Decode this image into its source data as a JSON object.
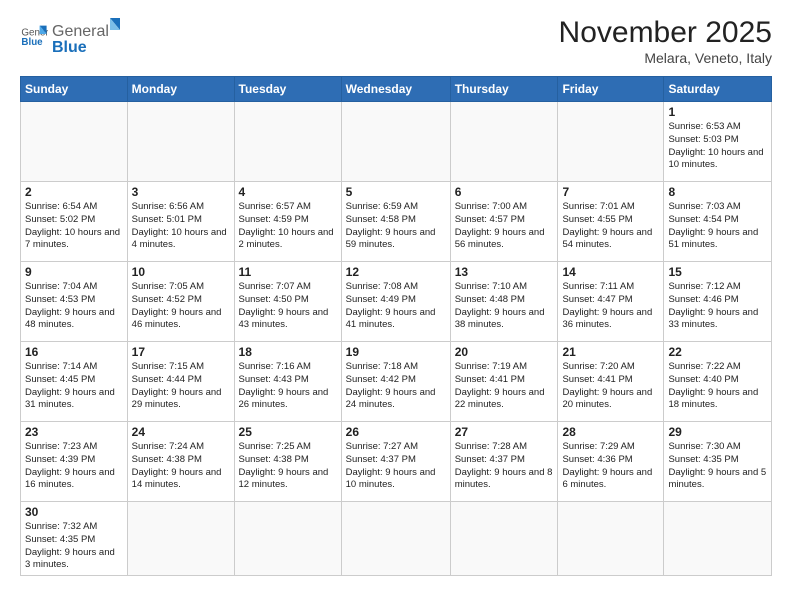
{
  "logo": {
    "general": "General",
    "blue": "Blue"
  },
  "header": {
    "month": "November 2025",
    "location": "Melara, Veneto, Italy"
  },
  "days_of_week": [
    "Sunday",
    "Monday",
    "Tuesday",
    "Wednesday",
    "Thursday",
    "Friday",
    "Saturday"
  ],
  "weeks": [
    [
      {
        "day": "",
        "info": ""
      },
      {
        "day": "",
        "info": ""
      },
      {
        "day": "",
        "info": ""
      },
      {
        "day": "",
        "info": ""
      },
      {
        "day": "",
        "info": ""
      },
      {
        "day": "",
        "info": ""
      },
      {
        "day": "1",
        "info": "Sunrise: 6:53 AM\nSunset: 5:03 PM\nDaylight: 10 hours and 10 minutes."
      }
    ],
    [
      {
        "day": "2",
        "info": "Sunrise: 6:54 AM\nSunset: 5:02 PM\nDaylight: 10 hours and 7 minutes."
      },
      {
        "day": "3",
        "info": "Sunrise: 6:56 AM\nSunset: 5:01 PM\nDaylight: 10 hours and 4 minutes."
      },
      {
        "day": "4",
        "info": "Sunrise: 6:57 AM\nSunset: 4:59 PM\nDaylight: 10 hours and 2 minutes."
      },
      {
        "day": "5",
        "info": "Sunrise: 6:59 AM\nSunset: 4:58 PM\nDaylight: 9 hours and 59 minutes."
      },
      {
        "day": "6",
        "info": "Sunrise: 7:00 AM\nSunset: 4:57 PM\nDaylight: 9 hours and 56 minutes."
      },
      {
        "day": "7",
        "info": "Sunrise: 7:01 AM\nSunset: 4:55 PM\nDaylight: 9 hours and 54 minutes."
      },
      {
        "day": "8",
        "info": "Sunrise: 7:03 AM\nSunset: 4:54 PM\nDaylight: 9 hours and 51 minutes."
      }
    ],
    [
      {
        "day": "9",
        "info": "Sunrise: 7:04 AM\nSunset: 4:53 PM\nDaylight: 9 hours and 48 minutes."
      },
      {
        "day": "10",
        "info": "Sunrise: 7:05 AM\nSunset: 4:52 PM\nDaylight: 9 hours and 46 minutes."
      },
      {
        "day": "11",
        "info": "Sunrise: 7:07 AM\nSunset: 4:50 PM\nDaylight: 9 hours and 43 minutes."
      },
      {
        "day": "12",
        "info": "Sunrise: 7:08 AM\nSunset: 4:49 PM\nDaylight: 9 hours and 41 minutes."
      },
      {
        "day": "13",
        "info": "Sunrise: 7:10 AM\nSunset: 4:48 PM\nDaylight: 9 hours and 38 minutes."
      },
      {
        "day": "14",
        "info": "Sunrise: 7:11 AM\nSunset: 4:47 PM\nDaylight: 9 hours and 36 minutes."
      },
      {
        "day": "15",
        "info": "Sunrise: 7:12 AM\nSunset: 4:46 PM\nDaylight: 9 hours and 33 minutes."
      }
    ],
    [
      {
        "day": "16",
        "info": "Sunrise: 7:14 AM\nSunset: 4:45 PM\nDaylight: 9 hours and 31 minutes."
      },
      {
        "day": "17",
        "info": "Sunrise: 7:15 AM\nSunset: 4:44 PM\nDaylight: 9 hours and 29 minutes."
      },
      {
        "day": "18",
        "info": "Sunrise: 7:16 AM\nSunset: 4:43 PM\nDaylight: 9 hours and 26 minutes."
      },
      {
        "day": "19",
        "info": "Sunrise: 7:18 AM\nSunset: 4:42 PM\nDaylight: 9 hours and 24 minutes."
      },
      {
        "day": "20",
        "info": "Sunrise: 7:19 AM\nSunset: 4:41 PM\nDaylight: 9 hours and 22 minutes."
      },
      {
        "day": "21",
        "info": "Sunrise: 7:20 AM\nSunset: 4:41 PM\nDaylight: 9 hours and 20 minutes."
      },
      {
        "day": "22",
        "info": "Sunrise: 7:22 AM\nSunset: 4:40 PM\nDaylight: 9 hours and 18 minutes."
      }
    ],
    [
      {
        "day": "23",
        "info": "Sunrise: 7:23 AM\nSunset: 4:39 PM\nDaylight: 9 hours and 16 minutes."
      },
      {
        "day": "24",
        "info": "Sunrise: 7:24 AM\nSunset: 4:38 PM\nDaylight: 9 hours and 14 minutes."
      },
      {
        "day": "25",
        "info": "Sunrise: 7:25 AM\nSunset: 4:38 PM\nDaylight: 9 hours and 12 minutes."
      },
      {
        "day": "26",
        "info": "Sunrise: 7:27 AM\nSunset: 4:37 PM\nDaylight: 9 hours and 10 minutes."
      },
      {
        "day": "27",
        "info": "Sunrise: 7:28 AM\nSunset: 4:37 PM\nDaylight: 9 hours and 8 minutes."
      },
      {
        "day": "28",
        "info": "Sunrise: 7:29 AM\nSunset: 4:36 PM\nDaylight: 9 hours and 6 minutes."
      },
      {
        "day": "29",
        "info": "Sunrise: 7:30 AM\nSunset: 4:35 PM\nDaylight: 9 hours and 5 minutes."
      }
    ],
    [
      {
        "day": "30",
        "info": "Sunrise: 7:32 AM\nSunset: 4:35 PM\nDaylight: 9 hours and 3 minutes."
      },
      {
        "day": "",
        "info": ""
      },
      {
        "day": "",
        "info": ""
      },
      {
        "day": "",
        "info": ""
      },
      {
        "day": "",
        "info": ""
      },
      {
        "day": "",
        "info": ""
      },
      {
        "day": "",
        "info": ""
      }
    ]
  ]
}
